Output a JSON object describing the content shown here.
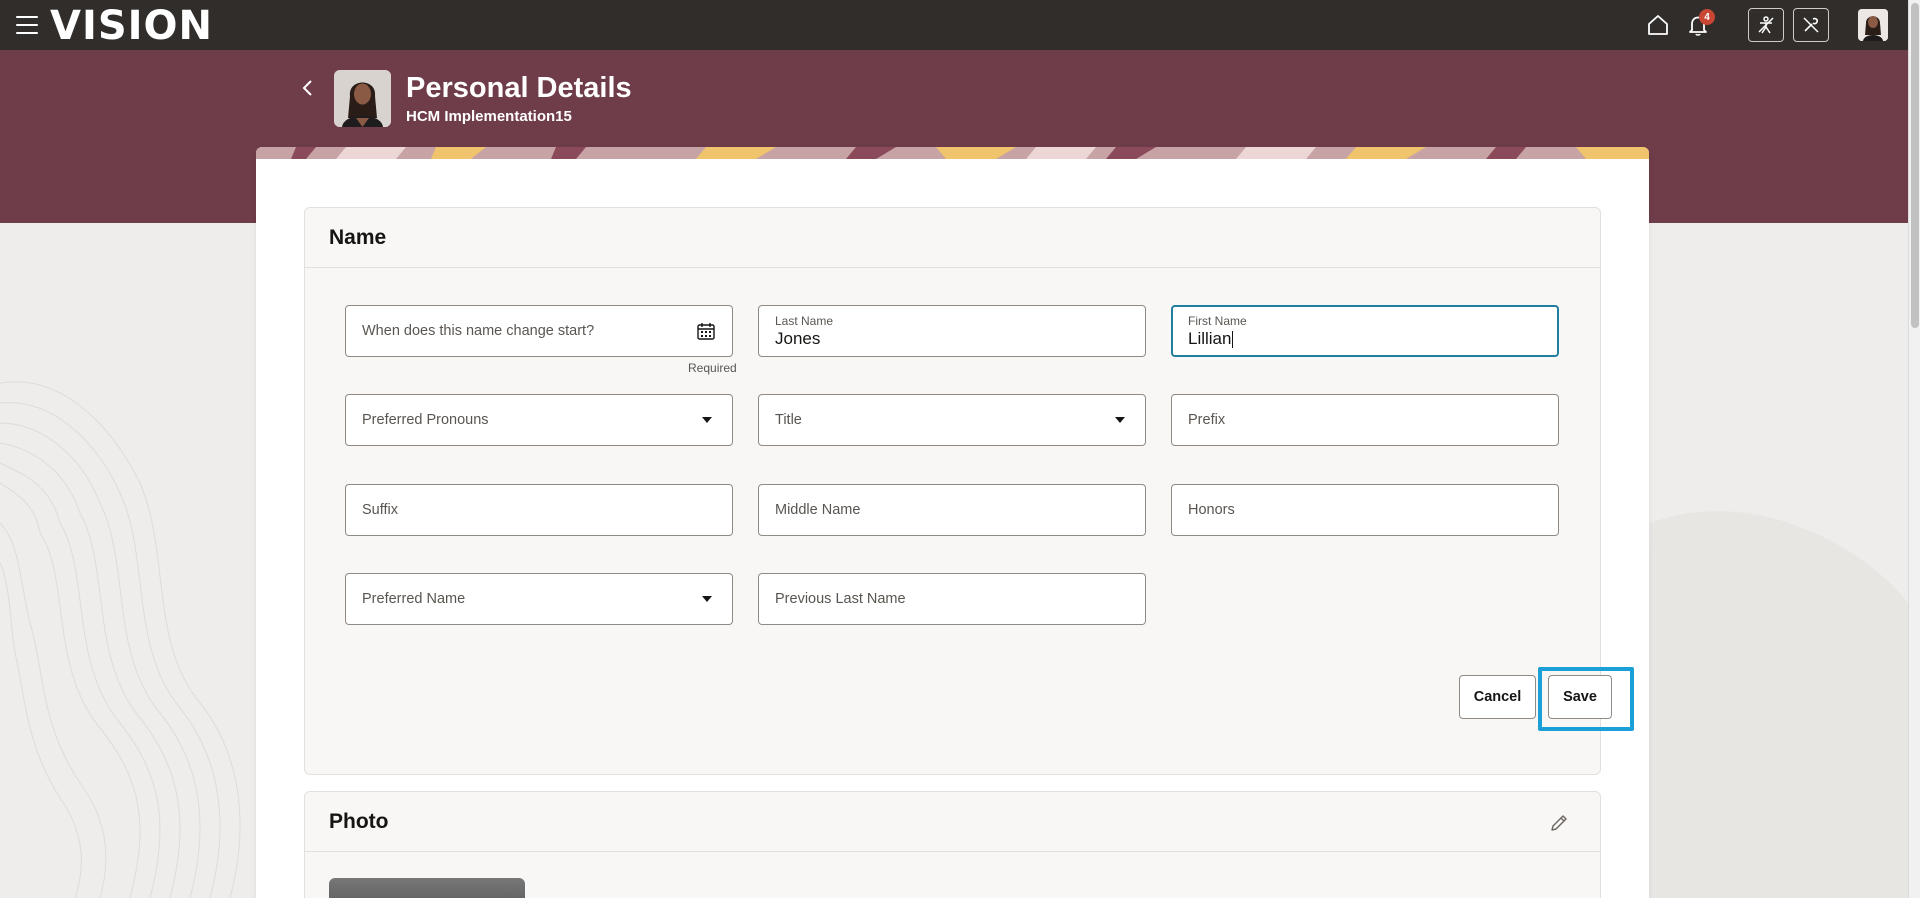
{
  "app": {
    "logo": "VISION"
  },
  "topbar": {
    "notification_count": "4",
    "icons": [
      "menu-icon",
      "home-icon",
      "bell-icon",
      "accessibility-icon",
      "tools-icon"
    ]
  },
  "header": {
    "title": "Personal Details",
    "subtitle": "HCM Implementation15"
  },
  "name_section": {
    "title": "Name",
    "fields": {
      "start_date": {
        "placeholder": "When does this name change start?",
        "helper": "Required"
      },
      "last_name": {
        "label": "Last Name",
        "value": "Jones"
      },
      "first_name": {
        "label": "First Name",
        "value": "Lillian"
      },
      "preferred_pronouns": {
        "placeholder": "Preferred Pronouns"
      },
      "title": {
        "placeholder": "Title"
      },
      "prefix": {
        "placeholder": "Prefix"
      },
      "suffix": {
        "placeholder": "Suffix"
      },
      "middle_name": {
        "placeholder": "Middle Name"
      },
      "honors": {
        "placeholder": "Honors"
      },
      "preferred_name": {
        "placeholder": "Preferred Name"
      },
      "previous_last_name": {
        "placeholder": "Previous Last Name"
      }
    },
    "buttons": {
      "cancel": "Cancel",
      "save": "Save"
    }
  },
  "photo_section": {
    "title": "Photo"
  },
  "colors": {
    "topbar": "#312d2a",
    "hero": "#6f3d49",
    "focus_outline": "#1a9fd6",
    "field_focus": "#227e9e",
    "badge": "#c74634"
  }
}
